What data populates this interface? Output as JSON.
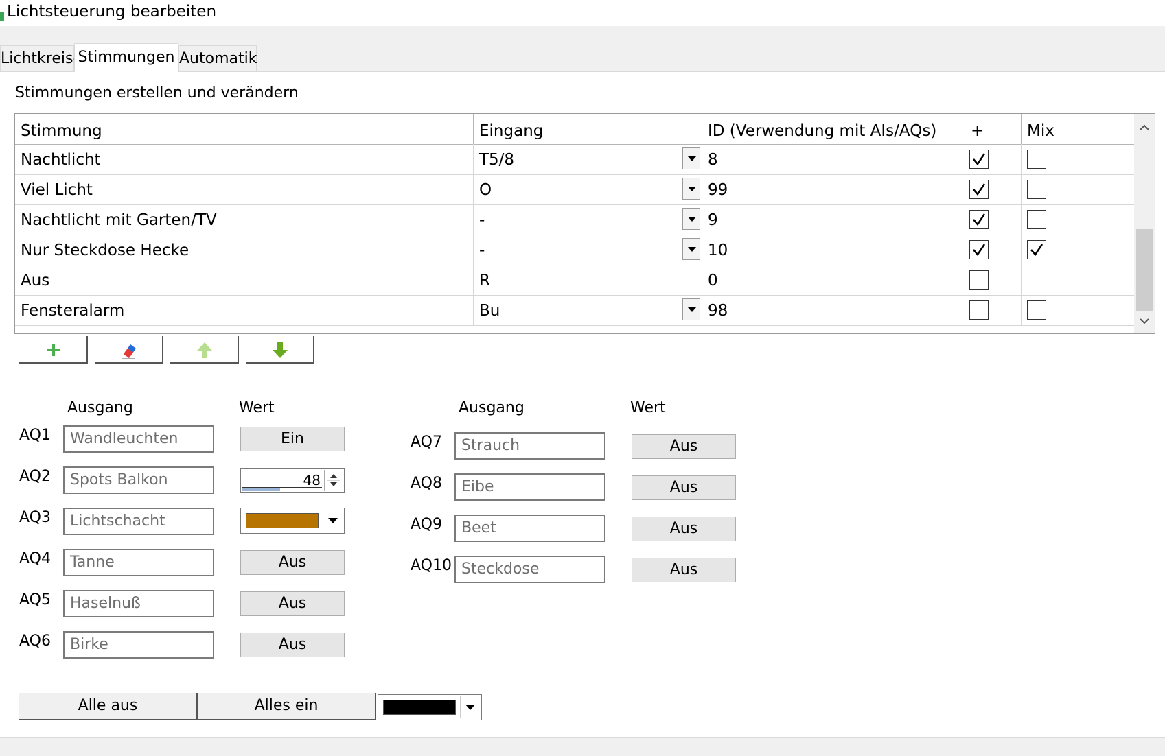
{
  "window": {
    "title": "Lichtsteuerung bearbeiten"
  },
  "tabs": [
    "Lichtkreise",
    "Stimmungen",
    "Automatik"
  ],
  "section_title": "Stimmungen erstellen und verändern",
  "table": {
    "columns": [
      "Stimmung",
      "Eingang",
      "ID (Verwendung mit AIs/AQs)",
      "+",
      "Mix"
    ],
    "rows": [
      {
        "name": "Nachtlicht",
        "input": "T5/8",
        "id": "8",
        "plus": true,
        "mix": false
      },
      {
        "name": "Viel Licht",
        "input": "O",
        "id": "99",
        "plus": true,
        "mix": false
      },
      {
        "name": "Nachtlicht mit Garten/TV",
        "input": "-",
        "id": "9",
        "plus": true,
        "mix": false
      },
      {
        "name": "Nur Steckdose Hecke",
        "input": "-",
        "id": "10",
        "plus": true,
        "mix": true
      },
      {
        "name": "Aus",
        "input": "R",
        "id": "0",
        "plus": false,
        "mix": null
      },
      {
        "name": "Fensteralarm",
        "input": "Bu",
        "id": "98",
        "plus": false,
        "mix": false
      }
    ]
  },
  "toolbar_icons": [
    "plus-icon",
    "eraser-icon",
    "arrow-up-icon",
    "arrow-down-icon"
  ],
  "outputs_headers": {
    "ausgang": "Ausgang",
    "wert": "Wert"
  },
  "outputs_left": [
    {
      "label": "AQ1",
      "name": "Wandleuchten",
      "value": "Ein"
    },
    {
      "label": "AQ2",
      "name": "Spots Balkon",
      "value": "48",
      "control": "spinner"
    },
    {
      "label": "AQ3",
      "name": "Lichtschacht",
      "control": "color"
    },
    {
      "label": "AQ4",
      "name": "Tanne",
      "value": "Aus"
    },
    {
      "label": "AQ5",
      "name": "Haselnuß",
      "value": "Aus"
    },
    {
      "label": "AQ6",
      "name": "Birke",
      "value": "Aus"
    }
  ],
  "outputs_right": [
    {
      "label": "AQ7",
      "name": "Strauch",
      "value": "Aus"
    },
    {
      "label": "AQ8",
      "name": "Eibe",
      "value": "Aus"
    },
    {
      "label": "AQ9",
      "name": "Beet",
      "value": "Aus"
    },
    {
      "label": "AQ10",
      "name": "Steckdose",
      "value": "Aus"
    }
  ],
  "colors": {
    "aq3_swatch": "#b87400",
    "all_swatch": "#000000"
  },
  "bottom_buttons": {
    "all_off": "Alle aus",
    "all_on": "Alles ein"
  }
}
